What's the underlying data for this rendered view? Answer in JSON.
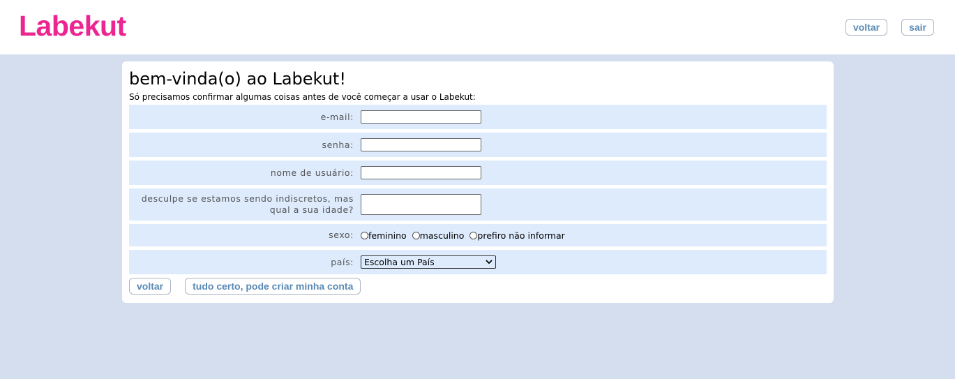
{
  "header": {
    "logo_text": "Labekut",
    "back_label": "voltar",
    "exit_label": "sair"
  },
  "card": {
    "title": "bem-vinda(o) ao Labekut!",
    "subtitle": "Só precisamos confirmar algumas coisas antes de você começar a usar o Labekut:"
  },
  "form": {
    "email_label": "e-mail:",
    "email_value": "",
    "password_label": "senha:",
    "password_value": "",
    "username_label": "nome de usuário:",
    "username_value": "",
    "age_label_line1": "desculpe se estamos sendo indiscretos, mas",
    "age_label_line2": "qual a sua idade?",
    "age_value": "",
    "sex_label": "sexo:",
    "sex_options": [
      "feminino",
      "masculino",
      "prefiro não informar"
    ],
    "country_label": "país:",
    "country_selected": "Escolha um País"
  },
  "actions": {
    "back_label": "voltar",
    "submit_label": "tudo certo, pode criar minha conta"
  },
  "colors": {
    "brand": "#ed2590",
    "page_bg": "#d4deee",
    "row_bg": "#ddebfd",
    "button_text": "#5a8ab5"
  }
}
